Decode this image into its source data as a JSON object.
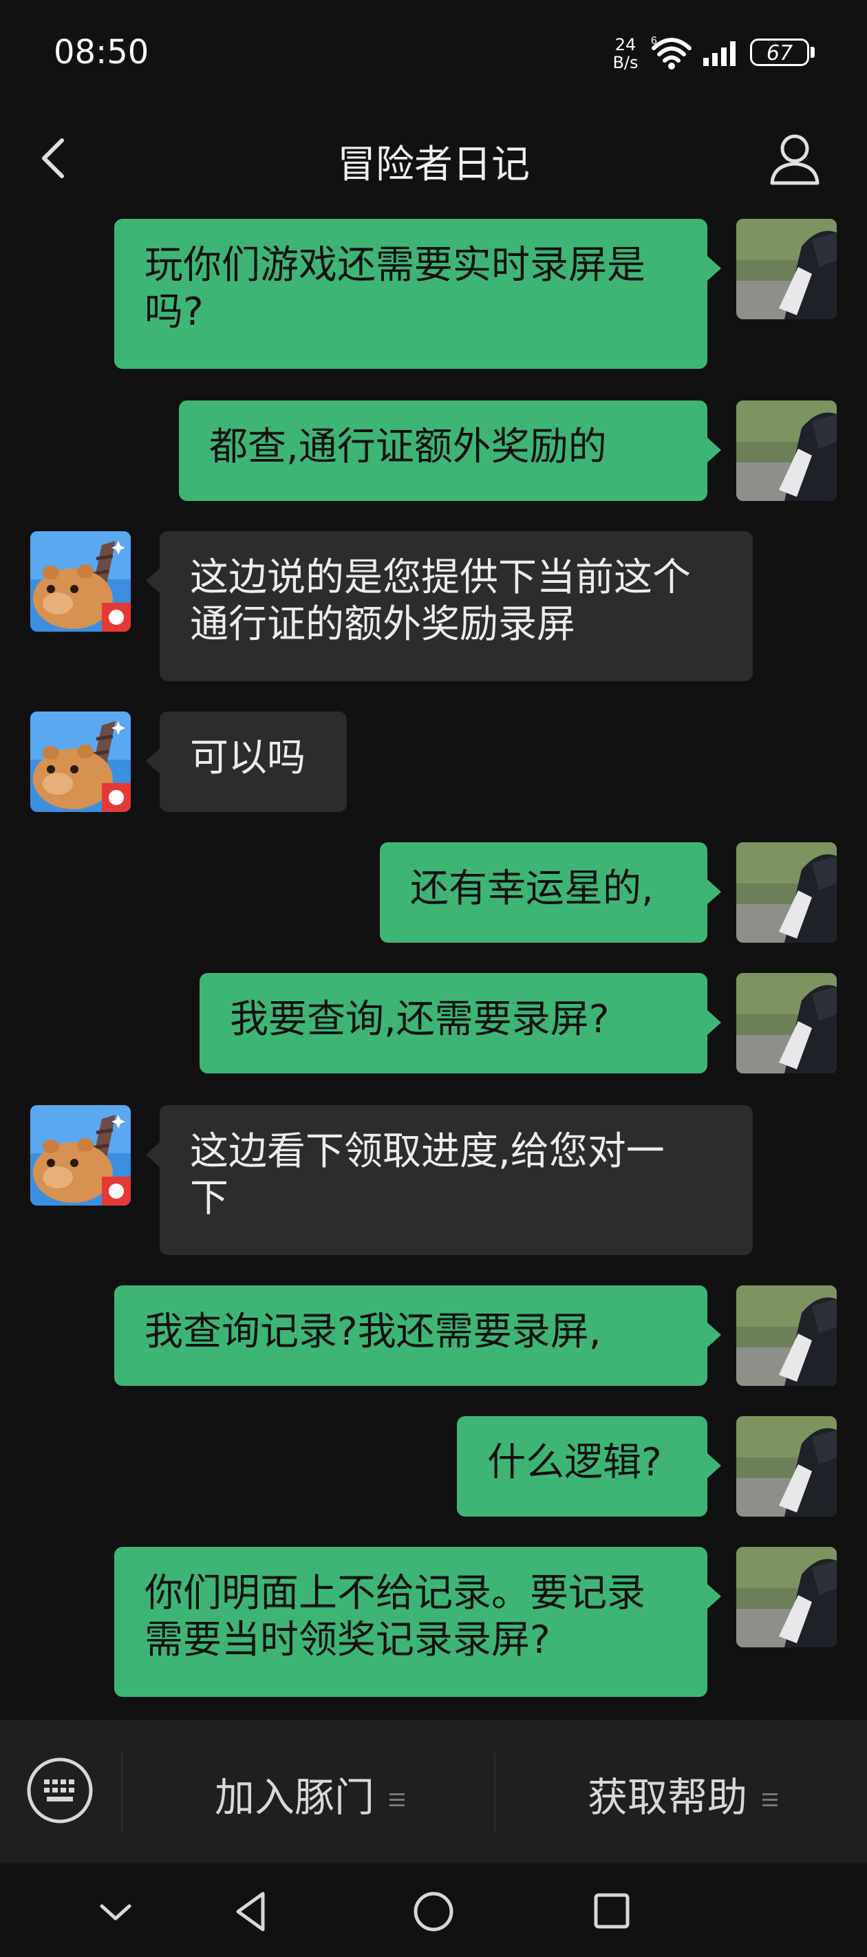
{
  "status": {
    "time": "08:50",
    "net_speed_top": "24",
    "net_speed_bottom": "B/s",
    "battery": "67"
  },
  "header": {
    "title": "冒险者日记"
  },
  "colors": {
    "my_bubble": "#3eb575",
    "their_bubble": "#2c2c2c",
    "background": "#111111"
  },
  "messages": [
    {
      "sender": "me",
      "text": "玩你们游戏还需要实时录屏是\n吗?"
    },
    {
      "sender": "me",
      "text": "都查,通行证额外奖励的"
    },
    {
      "sender": "them",
      "text": "这边说的是您提供下当前这个\n通行证的额外奖励录屏"
    },
    {
      "sender": "them",
      "text": "可以吗"
    },
    {
      "sender": "me",
      "text": "还有幸运星的,"
    },
    {
      "sender": "me",
      "text": "我要查询,还需要录屏?"
    },
    {
      "sender": "them",
      "text": "这边看下领取进度,给您对一\n下"
    },
    {
      "sender": "me",
      "text": "我查询记录?我还需要录屏,"
    },
    {
      "sender": "me",
      "text": "什么逻辑?"
    },
    {
      "sender": "me",
      "text": "你们明面上不给记录。要记录\n需要当时领奖记录录屏?"
    }
  ],
  "menu": {
    "item1": "加入豚门",
    "item2": "获取帮助"
  },
  "icons": {
    "back": "chevron-left-icon",
    "profile": "person-icon",
    "keyboard": "keyboard-icon",
    "nav_down": "chevron-down-icon",
    "nav_back": "triangle-back-icon",
    "nav_home": "circle-home-icon",
    "nav_recent": "square-recent-icon"
  }
}
